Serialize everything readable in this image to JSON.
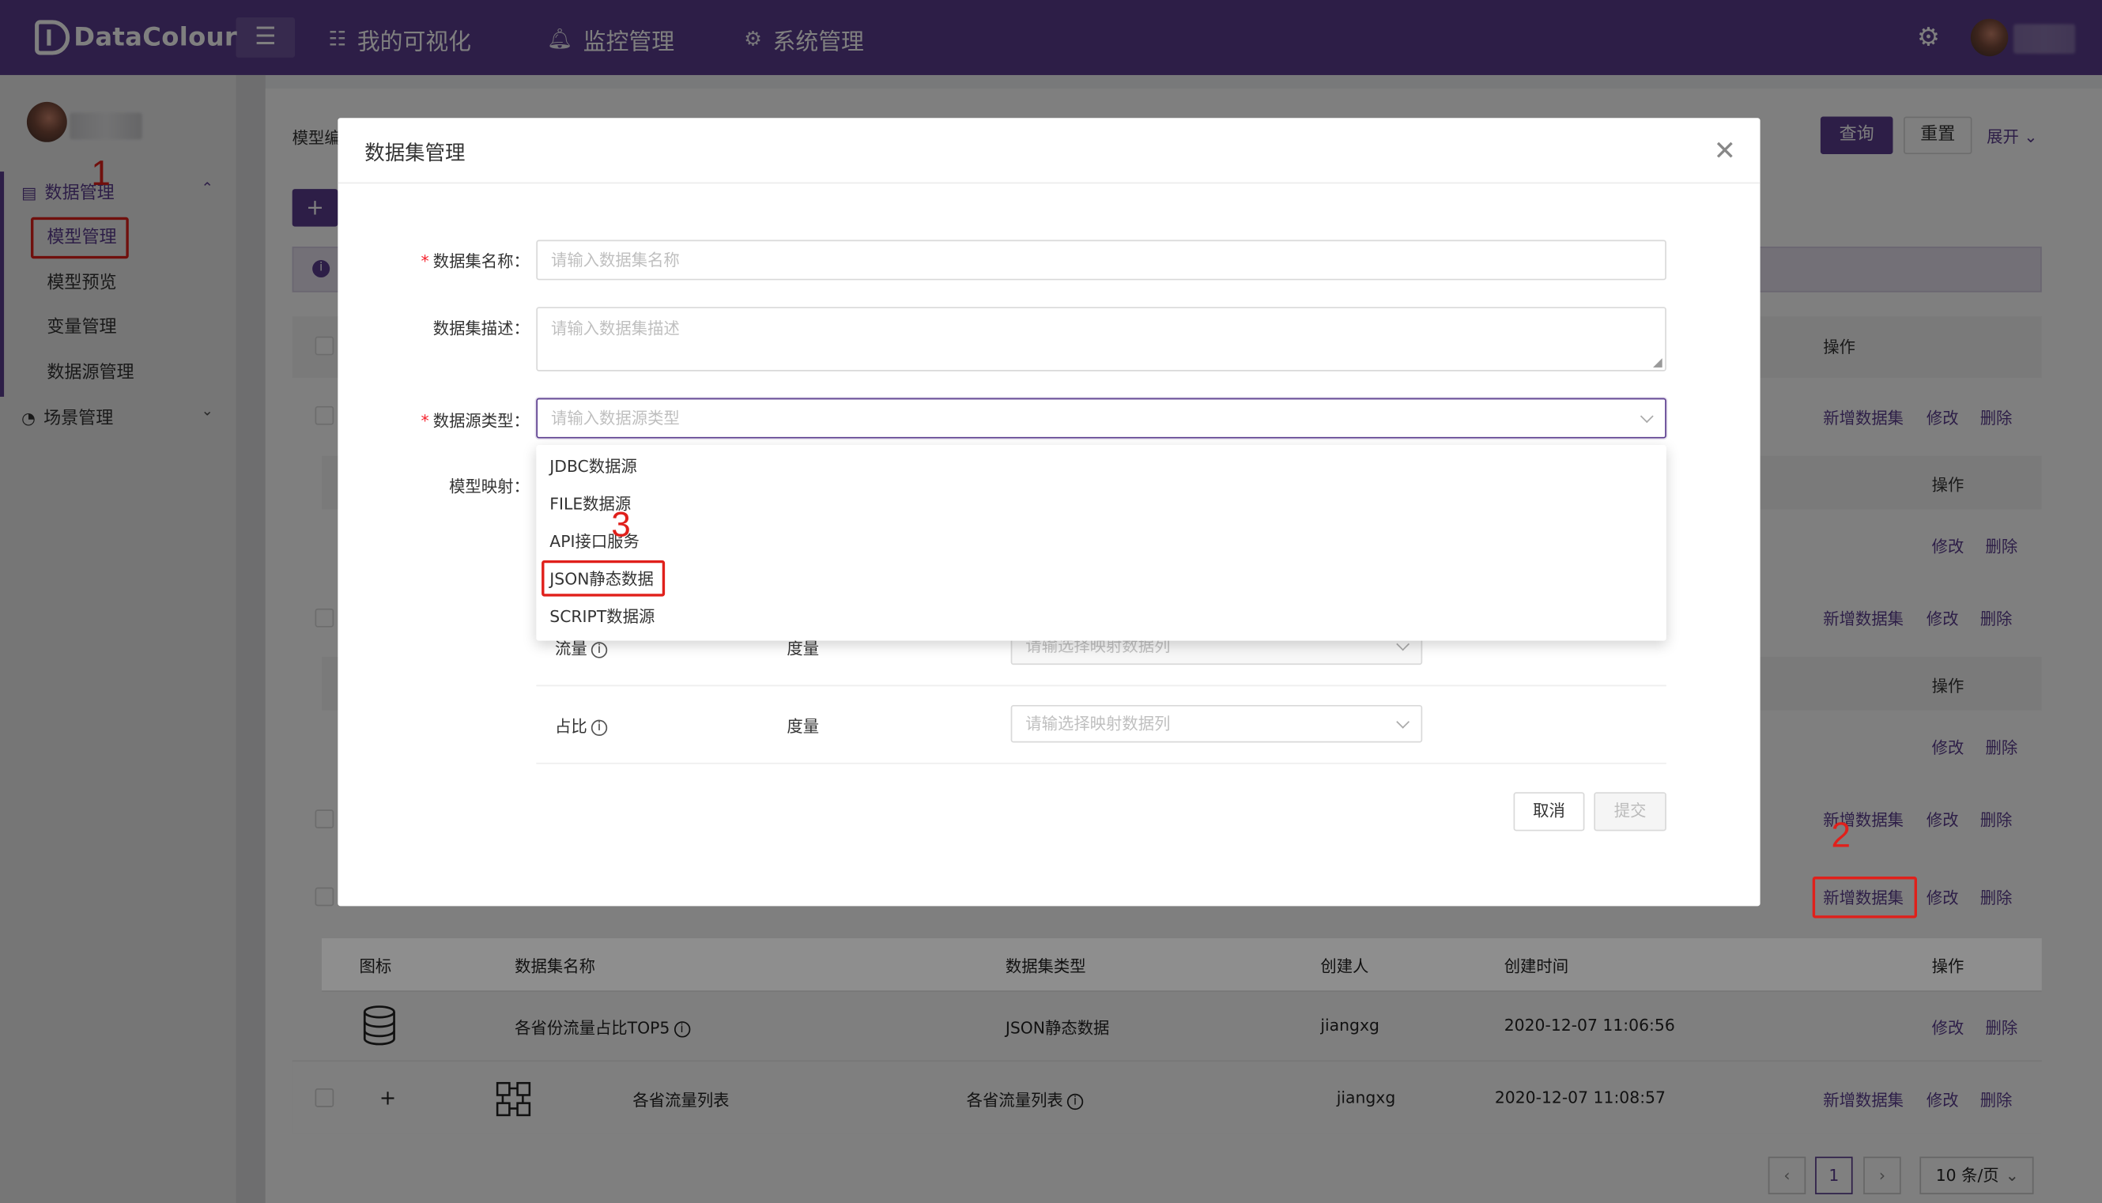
{
  "header": {
    "logo_text": "DataColour",
    "nav": [
      {
        "icon": "list-icon",
        "label": "我的可视化"
      },
      {
        "icon": "bell-icon",
        "label": "监控管理"
      },
      {
        "icon": "gear-icon",
        "label": "系统管理"
      }
    ]
  },
  "sidebar": {
    "groups": [
      {
        "label": "数据管理",
        "items": [
          "模型管理",
          "模型预览",
          "变量管理",
          "数据源管理"
        ]
      },
      {
        "label": "场景管理"
      }
    ]
  },
  "toolbar": {
    "query_label": "查询",
    "reset_label": "重置",
    "expand_label": "展开"
  },
  "page": {
    "field_label_partial": "模型编",
    "add_label": "+"
  },
  "table": {
    "op_header": "操作",
    "row_actions": {
      "add": "新增数据集",
      "edit": "修改",
      "delete": "删除"
    },
    "dataset_headers": [
      "图标",
      "数据集名称",
      "数据集类型",
      "创建人",
      "创建时间",
      "操作"
    ],
    "dataset_row": {
      "name": "各省份流量占比TOP5",
      "type": "JSON静态数据",
      "creator": "jiangxg",
      "time": "2020-12-07 11:06:56"
    },
    "model_row": {
      "expand": "+",
      "name": "各省流量列表",
      "name2": "各省流量列表",
      "creator": "jiangxg",
      "time": "2020-12-07 11:08:57"
    }
  },
  "pagination": {
    "current": "1",
    "page_size": "10 条/页"
  },
  "modal": {
    "title": "数据集管理",
    "fields": {
      "name_label": "数据集名称：",
      "name_placeholder": "请输入数据集名称",
      "desc_label": "数据集描述：",
      "desc_placeholder": "请输入数据集描述",
      "source_label": "数据源类型：",
      "source_placeholder": "请输入数据源类型",
      "mapping_label": "模型映射："
    },
    "dropdown_options": [
      "JDBC数据源",
      "FILE数据源",
      "API接口服务",
      "JSON静态数据",
      "SCRIPT数据源"
    ],
    "mapping_rows": [
      {
        "field": "流量",
        "kind": "度量",
        "placeholder": "请输选择映射数据列"
      },
      {
        "field": "占比",
        "kind": "度量",
        "placeholder": "请输选择映射数据列"
      }
    ],
    "cancel_label": "取消",
    "submit_label": "提交"
  },
  "annotations": {
    "step1": "1",
    "step2": "2",
    "step3": "3"
  },
  "colors": {
    "brand": "#5b3d8f",
    "annotation": "#e0201b",
    "danger_required": "#f5222d"
  }
}
